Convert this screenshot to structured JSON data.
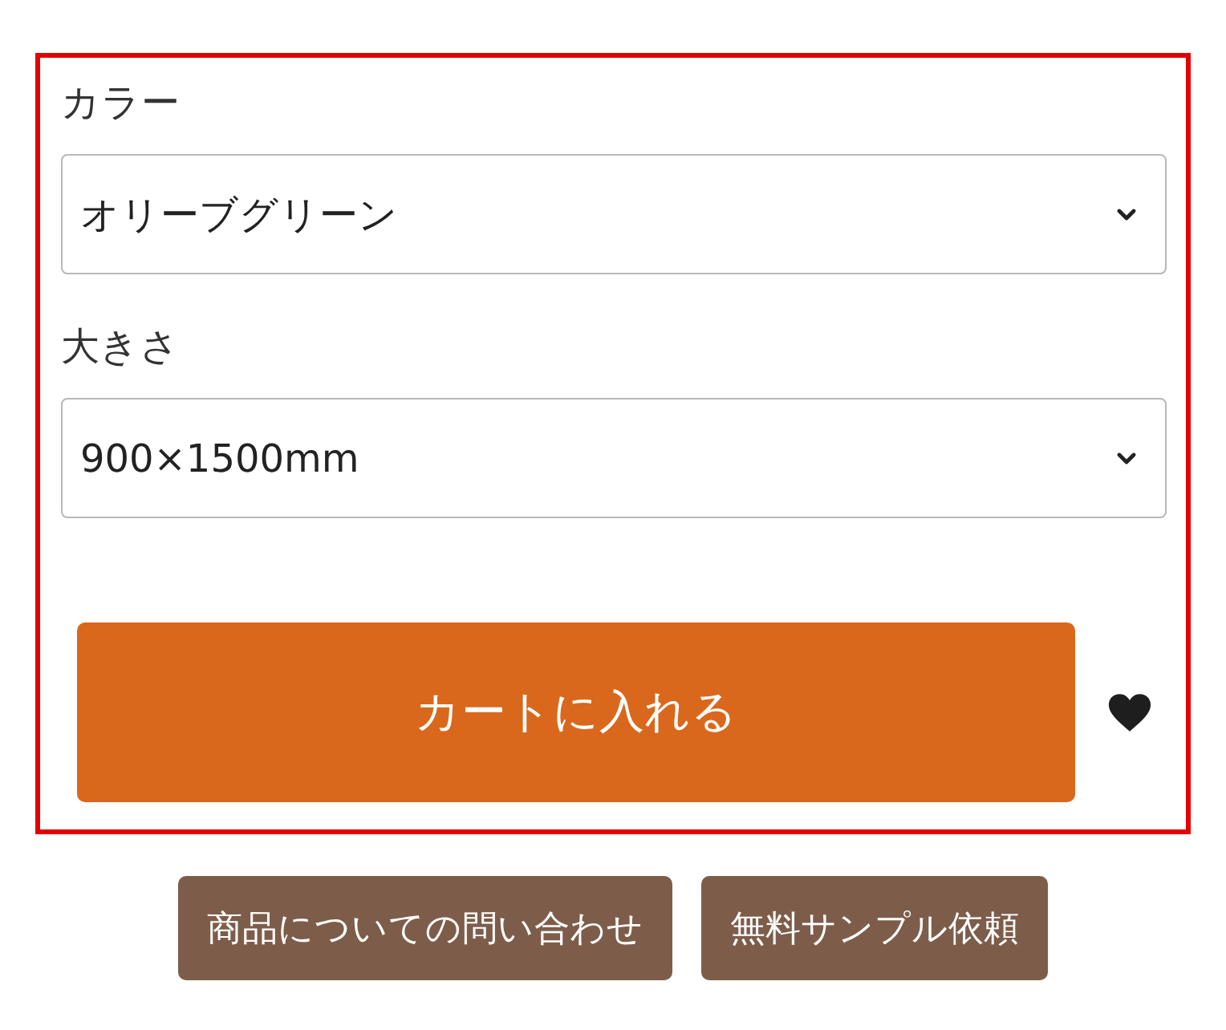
{
  "panel": {
    "highlighted": true,
    "fields": [
      {
        "label": "カラー",
        "value": "オリーブグリーン"
      },
      {
        "label": "大きさ",
        "value": "900×1500mm"
      }
    ],
    "cart_button": {
      "label": "カートに入れる"
    }
  },
  "buttons": [
    {
      "label": "商品についての問い合わせ"
    },
    {
      "label": "無料サンプル依頼"
    }
  ]
}
